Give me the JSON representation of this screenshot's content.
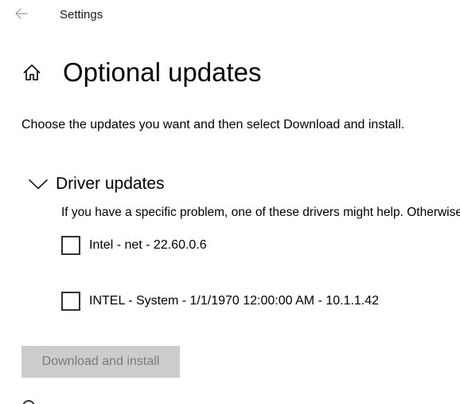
{
  "window": {
    "title": "Settings",
    "back_icon": "arrow-left-icon"
  },
  "header": {
    "home_icon": "home-icon",
    "title": "Optional updates"
  },
  "intro": "Choose the updates you want and then select Download and install.",
  "driver_updates": {
    "title": "Driver updates",
    "expand_icon": "chevron-down-icon",
    "description": "If you have a specific problem, one of these drivers might help. Otherwise, automatic updates will keep your drivers up to date.",
    "items": [
      {
        "label": "Intel - net - 22.60.0.6",
        "checked": false
      },
      {
        "label": "INTEL - System - 1/1/1970 12:00:00 AM - 10.1.1.42",
        "checked": false
      }
    ]
  },
  "actions": {
    "download_label": "Download and install",
    "download_enabled": false
  },
  "colors": {
    "background": "#ffffff",
    "text": "#000000",
    "disabled_button_bg": "#cccccc",
    "disabled_button_text": "#7a7a7a",
    "back_arrow": "#9a9a9a"
  }
}
